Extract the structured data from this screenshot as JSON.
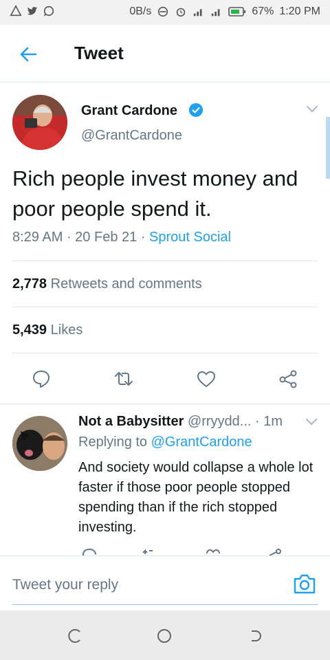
{
  "status_bar": {
    "left_icons": [
      "alert-triangle-icon",
      "twitter-icon",
      "whatsapp-icon"
    ],
    "network_speed": "0B/s",
    "battery": "67%",
    "time": "1:20 PM"
  },
  "app_bar": {
    "back_icon": "arrow-left-icon",
    "title": "Tweet"
  },
  "tweet": {
    "author_name": "Grant Cardone",
    "author_handle": "@GrantCardone",
    "verified": true,
    "text": "Rich people invest money and poor people spend it.",
    "time": "8:29 AM",
    "date": "20 Feb 21",
    "source": "Sprout Social",
    "retweets_count": "2,778",
    "retweets_label": "Retweets and comments",
    "likes_count": "5,439",
    "likes_label": "Likes"
  },
  "tweet_actions": [
    "reply-icon",
    "retweet-icon",
    "like-icon",
    "share-icon"
  ],
  "reply": {
    "author_name": "Not a Babysitter",
    "author_handle": "@rryydd...",
    "time_sep": "·",
    "time": "1m",
    "replying_prefix": "Replying to",
    "replying_user": "@GrantCardone",
    "text": "And society would collapse a whole lot faster if those poor people stopped spending than if the rich stopped investing."
  },
  "composer": {
    "placeholder": "Tweet your reply",
    "camera_icon": "camera-icon"
  },
  "nav_bar": [
    "recent-apps-icon",
    "home-icon",
    "back-icon"
  ],
  "colors": {
    "accent": "#1da1f2",
    "text": "#14171a",
    "secondary": "#657786",
    "divider": "#e1e8ed"
  }
}
